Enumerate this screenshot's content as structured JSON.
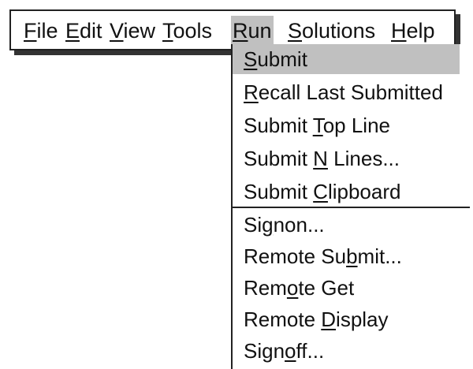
{
  "menubar": {
    "items": [
      {
        "pre": "",
        "key": "F",
        "post": "ile"
      },
      {
        "pre": "",
        "key": "E",
        "post": "dit"
      },
      {
        "pre": "",
        "key": "V",
        "post": "iew"
      },
      {
        "pre": "",
        "key": "T",
        "post": "ools"
      },
      {
        "pre": "",
        "key": "R",
        "post": "un"
      },
      {
        "pre": "",
        "key": "S",
        "post": "olutions"
      },
      {
        "pre": "",
        "key": "H",
        "post": "elp"
      }
    ],
    "active_item": "Run",
    "active_color": "#c0c0c0"
  },
  "run_menu": {
    "items": [
      {
        "pre": "",
        "key": "S",
        "post": "ubmit"
      },
      {
        "pre": "",
        "key": "R",
        "post": "ecall Last Submitted"
      },
      {
        "pre": "Submit ",
        "key": "T",
        "post": "op Line"
      },
      {
        "pre": "Submit ",
        "key": "N",
        "post": " Lines..."
      },
      {
        "pre": "Submit ",
        "key": "C",
        "post": "lipboard"
      },
      {
        "pre": "Si",
        "key": "g",
        "post": "non..."
      },
      {
        "pre": "Remote Su",
        "key": "b",
        "post": "mit..."
      },
      {
        "pre": "Rem",
        "key": "o",
        "post": "te Get"
      },
      {
        "pre": "Remote ",
        "key": "D",
        "post": "isplay"
      },
      {
        "pre": "Sign",
        "key": "o",
        "post": "ff..."
      }
    ],
    "highlighted_item": "Submit",
    "highlight_color": "#c0c0c0"
  }
}
